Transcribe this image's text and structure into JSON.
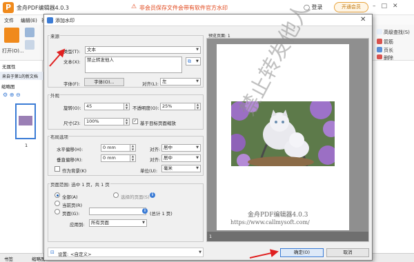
{
  "app": {
    "title": "金舟PDF编辑器4.0.3",
    "notice": "非会员保存文件会带有软件官方水印",
    "login": "登录",
    "vip": "开通会员",
    "menu": [
      "文件",
      "编辑(E)",
      "视图"
    ],
    "ribbon_right": [
      "高级查找(S)",
      "箭筋",
      "页长",
      "删除"
    ],
    "open_label": "打开(O)...",
    "no_property": "无属性",
    "doc_tab": "来自于第1的新文档",
    "thumbnails_title": "缩略图",
    "page_number": "1",
    "bottom_tabs": [
      "书签",
      "缩略图"
    ]
  },
  "dialog": {
    "title": "添加水印",
    "source": {
      "section": "来源",
      "type_label": "类型(T):",
      "type_value": "文本",
      "text_label": "文本(X):",
      "text_value": "禁止转发他人",
      "font_label": "字体(F):",
      "font_button": "字体(O)...",
      "align_label": "对齐(L):",
      "align_value": "左"
    },
    "appearance": {
      "section": "外观",
      "rotation_label": "旋转(O):",
      "rotation_value": "45",
      "opacity_label": "不透明度(O):",
      "opacity_value": "25%",
      "size_label": "尺寸(Z):",
      "size_value": "100%",
      "relative_label": "基于目标页面缩放",
      "relative_checked": true
    },
    "layout": {
      "section": "布局选项",
      "h_offset_label": "水平偏移(H):",
      "h_offset_value": "0 mm",
      "h_align_label": "对齐:",
      "h_align_value": "居中",
      "v_offset_label": "垂直偏移(R):",
      "v_offset_value": "0 mm",
      "v_align_label": "对齐:",
      "v_align_value": "居中",
      "background_label": "作为背景(K)",
      "background_checked": false,
      "unit_label": "单位(U):",
      "unit_value": "毫米"
    },
    "page_range": {
      "section": "页面范围: 选中 1 页，共 1 页",
      "all_label": "全部(A)",
      "selected_label": "选择的页面(S)",
      "current_label": "当前页(R)",
      "pages_label": "页面(G):",
      "pages_value": "",
      "total_label": "(总计 1 页)",
      "apply_label": "应用到:",
      "apply_value": "所有页面",
      "selected_option": "all"
    },
    "preview": {
      "title": "预览页面: 1",
      "watermark_text": "禁止转发他人",
      "brand_line1": "金舟PDF编辑器4.0.3",
      "brand_line2": "https://www.callmysoft.com/",
      "page_index": "1"
    },
    "footer": {
      "settings_label": "设置:",
      "settings_value": "<自定义>",
      "ok_label": "确定(O)",
      "cancel_label": "取消"
    }
  },
  "colors": {
    "accent": "#e0461a",
    "brand": "#f08a1c",
    "arrow": "#e02020"
  }
}
